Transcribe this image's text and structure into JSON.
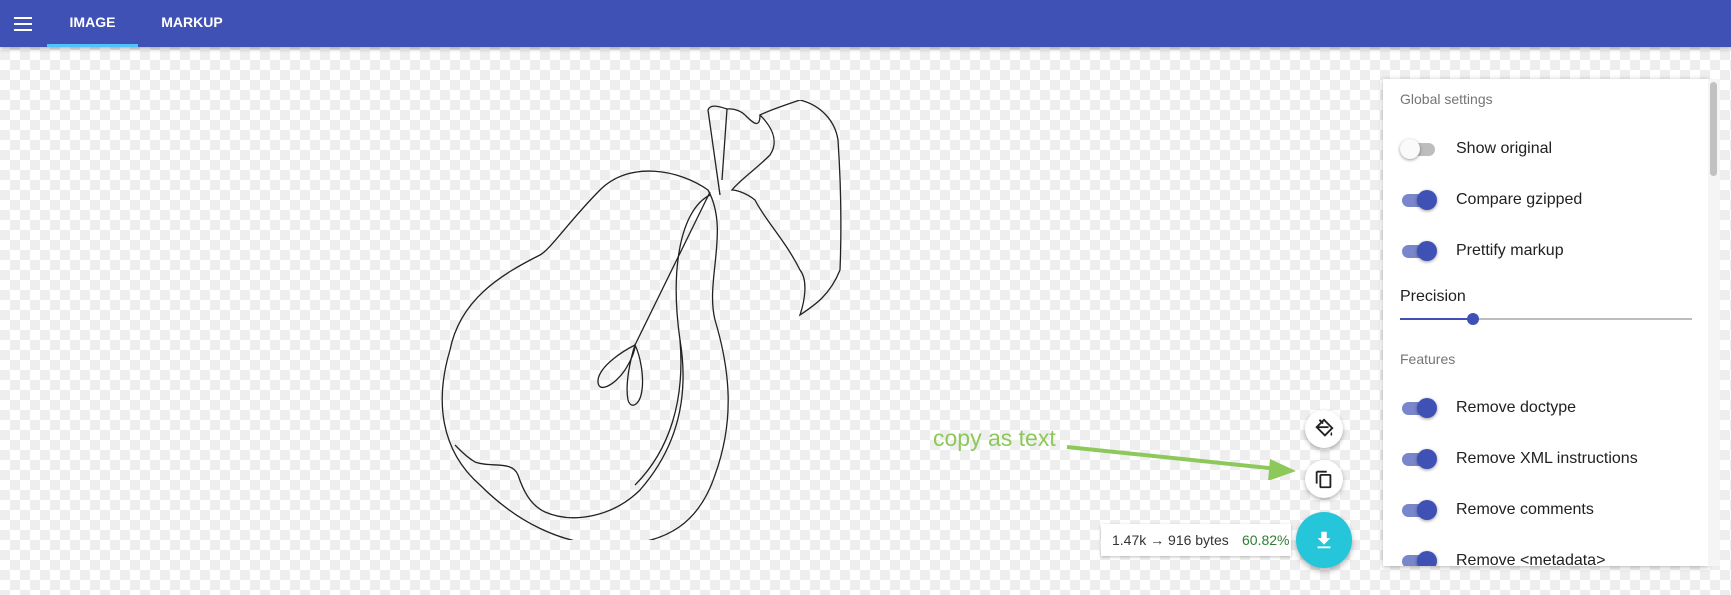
{
  "topbar": {
    "tabs": [
      {
        "label": "IMAGE",
        "active": true
      },
      {
        "label": "MARKUP",
        "active": false
      }
    ],
    "color": "#3f51b5",
    "indicator_color": "#4fc3f7"
  },
  "annotation": {
    "text": "copy as text",
    "color": "#8cc85a"
  },
  "actions": {
    "paint_icon": "paint-bucket-icon",
    "copy_icon": "copy-icon",
    "download_icon": "download-icon",
    "download_color": "#26c6da"
  },
  "size_info": {
    "text": "1.47k → 916 bytes",
    "percent": "60.82%"
  },
  "settings": {
    "global_heading": "Global settings",
    "global": [
      {
        "label": "Show original",
        "on": false
      },
      {
        "label": "Compare gzipped",
        "on": true
      },
      {
        "label": "Prettify markup",
        "on": true
      }
    ],
    "precision_label": "Precision",
    "precision_fraction": 0.25,
    "features_heading": "Features",
    "features": [
      {
        "label": "Remove doctype",
        "on": true
      },
      {
        "label": "Remove XML instructions",
        "on": true
      },
      {
        "label": "Remove comments",
        "on": true
      },
      {
        "label": "Remove <metadata>",
        "on": true
      }
    ]
  }
}
